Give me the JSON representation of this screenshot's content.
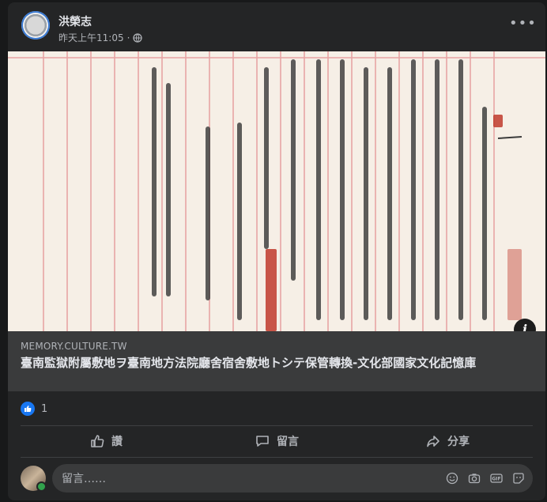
{
  "post": {
    "author": "洪榮志",
    "timestamp": "昨天上午11:05",
    "separator": "·",
    "privacy_icon": "globe-icon",
    "more_label": "•••"
  },
  "link_preview": {
    "domain": "MEMORY.CULTURE.TW",
    "title": "臺南監獄附屬敷地ヲ臺南地方法院廳舍宿舍敷地トシテ保管轉換-文化部國家文化記憶庫",
    "info_label": "i"
  },
  "reactions": {
    "count": "1",
    "icon": "like-icon"
  },
  "actions": {
    "like": "讚",
    "comment": "留言",
    "share": "分享"
  },
  "comment_box": {
    "placeholder": "留言……",
    "icons": [
      "emoji-icon",
      "camera-icon",
      "gif-icon",
      "sticker-icon"
    ]
  },
  "colors": {
    "background": "#18191a",
    "card": "#242526",
    "accent": "#1877f2",
    "online": "#31a24c"
  }
}
